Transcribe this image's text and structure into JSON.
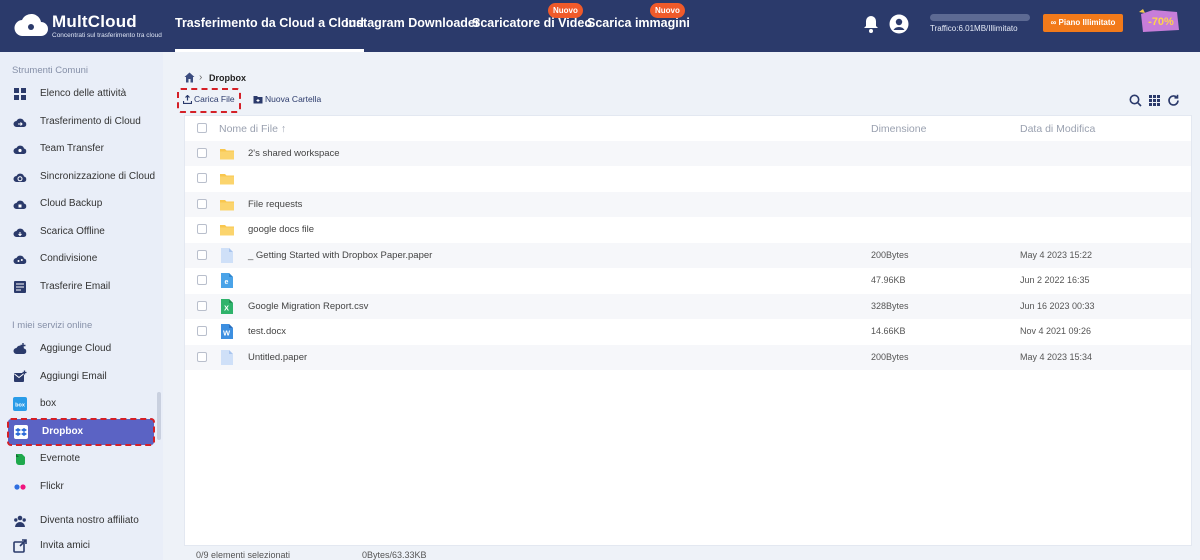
{
  "brand": {
    "name": "MultCloud",
    "tagline": "Concentrati sul trasferimento tra cloud"
  },
  "nav": {
    "items": [
      {
        "label": "Trasferimento da Cloud a Cloud",
        "active": true
      },
      {
        "label": "Instagram Downloader"
      },
      {
        "label": "Scaricatore di Video",
        "badge": "Nuovo"
      },
      {
        "label": "Scarica immagini",
        "badge": "Nuovo"
      }
    ]
  },
  "header": {
    "traffic_text": "Traffico:6.01MB/Illimitato",
    "traffic_used_fraction": 0.0,
    "plan_label": "Piano Illimitato",
    "promo_text": "-70%"
  },
  "sidebar": {
    "section1": "Strumenti Comuni",
    "tools": [
      {
        "label": "Elenco delle attività",
        "icon": "task-list-icon"
      },
      {
        "label": "Trasferimento di Cloud",
        "icon": "cloud-transfer-icon"
      },
      {
        "label": "Team Transfer",
        "icon": "team-transfer-icon"
      },
      {
        "label": "Sincronizzazione di Cloud",
        "icon": "cloud-sync-icon"
      },
      {
        "label": "Cloud Backup",
        "icon": "cloud-backup-icon"
      },
      {
        "label": "Scarica Offline",
        "icon": "offline-download-icon"
      },
      {
        "label": "Condivisione",
        "icon": "share-icon"
      },
      {
        "label": "Trasferire Email",
        "icon": "email-transfer-icon"
      }
    ],
    "section2": "I miei servizi online",
    "services": [
      {
        "label": "Aggiunge Cloud",
        "icon": "add-cloud-icon"
      },
      {
        "label": "Aggiungi Email",
        "icon": "add-email-icon"
      },
      {
        "label": "box",
        "icon": "box-icon"
      },
      {
        "label": "Dropbox",
        "icon": "dropbox-icon",
        "active": true
      },
      {
        "label": "Evernote",
        "icon": "evernote-icon"
      },
      {
        "label": "Flickr",
        "icon": "flickr-icon"
      }
    ],
    "footer": [
      {
        "label": "Diventa nostro affiliato",
        "icon": "affiliate-icon"
      },
      {
        "label": "Invita amici",
        "icon": "invite-icon"
      }
    ]
  },
  "breadcrumb": {
    "current": "Dropbox"
  },
  "toolbar": {
    "upload_label": "Carica File",
    "new_folder_label": "Nuova Cartella"
  },
  "table": {
    "columns": {
      "name": "Nome di File",
      "size": "Dimensione",
      "date": "Data di Modifica"
    },
    "rows": [
      {
        "type": "folder",
        "name": "2's shared workspace",
        "size": "",
        "date": ""
      },
      {
        "type": "folder",
        "name": "",
        "size": "",
        "date": ""
      },
      {
        "type": "folder",
        "name": "File requests",
        "size": "",
        "date": ""
      },
      {
        "type": "folder",
        "name": "google docs file",
        "size": "",
        "date": ""
      },
      {
        "type": "doc",
        "name": "_ Getting Started with Dropbox Paper.paper",
        "size": "200Bytes",
        "date": "May 4 2023 15:22"
      },
      {
        "type": "web",
        "name": "",
        "size": "47.96KB",
        "date": "Jun 2 2022 16:35"
      },
      {
        "type": "excel",
        "name": "Google Migration Report.csv",
        "size": "328Bytes",
        "date": "Jun 16 2023 00:33"
      },
      {
        "type": "word",
        "name": "test.docx",
        "size": "14.66KB",
        "date": "Nov 4 2021 09:26"
      },
      {
        "type": "doc",
        "name": "Untitled.paper",
        "size": "200Bytes",
        "date": "May 4 2023 15:34"
      }
    ]
  },
  "status": {
    "selected": "0/9 elementi selezionati",
    "size": "0Bytes/63.33KB"
  }
}
